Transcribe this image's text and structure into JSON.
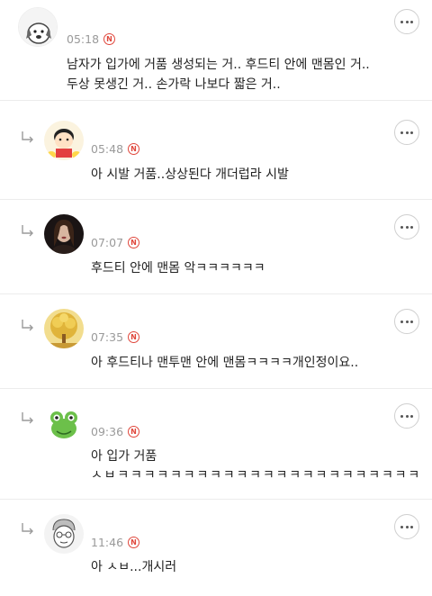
{
  "comments": [
    {
      "time": "05:18",
      "badge": "N",
      "avatar_icon": "dog-avatar-icon",
      "lines": [
        "남자가 입가에 거품 생성되는 거.. 후드티 안에 맨몸인 거..",
        "두상 못생긴 거.. 손가락 나보다 짧은 거.."
      ]
    },
    {
      "time": "05:48",
      "badge": "N",
      "avatar_icon": "cartoon-boy-avatar-icon",
      "lines": [
        "아 시발 거품..상상된다 개더럽라 시발"
      ]
    },
    {
      "time": "07:07",
      "badge": "N",
      "avatar_icon": "woman-portrait-avatar-icon",
      "lines": [
        "후드티 안에 맨몸  악ㅋㅋㅋㅋㅋㅋ"
      ]
    },
    {
      "time": "07:35",
      "badge": "N",
      "avatar_icon": "golden-tree-avatar-icon",
      "lines": [
        "아 후드티나 맨투맨 안에 맨몸ㅋㅋㅋㅋ개인정이요.."
      ]
    },
    {
      "time": "09:36",
      "badge": "N",
      "avatar_icon": "frog-avatar-icon",
      "lines": [
        "아 입가 거품",
        "ㅅㅂㅋㅋㅋㅋㅋㅋㅋㅋㅋㅋㅋㅋㅋㅋㅋㅋㅋㅋㅋㅋㅋㅋㅋ"
      ]
    },
    {
      "time": "11:46",
      "badge": "N",
      "avatar_icon": "sketch-face-avatar-icon",
      "lines": [
        "아 ㅅㅂ...개시러"
      ]
    }
  ],
  "colors": {
    "badge": "#e0473c",
    "time": "#9a9a9a",
    "divider": "#ececec"
  }
}
